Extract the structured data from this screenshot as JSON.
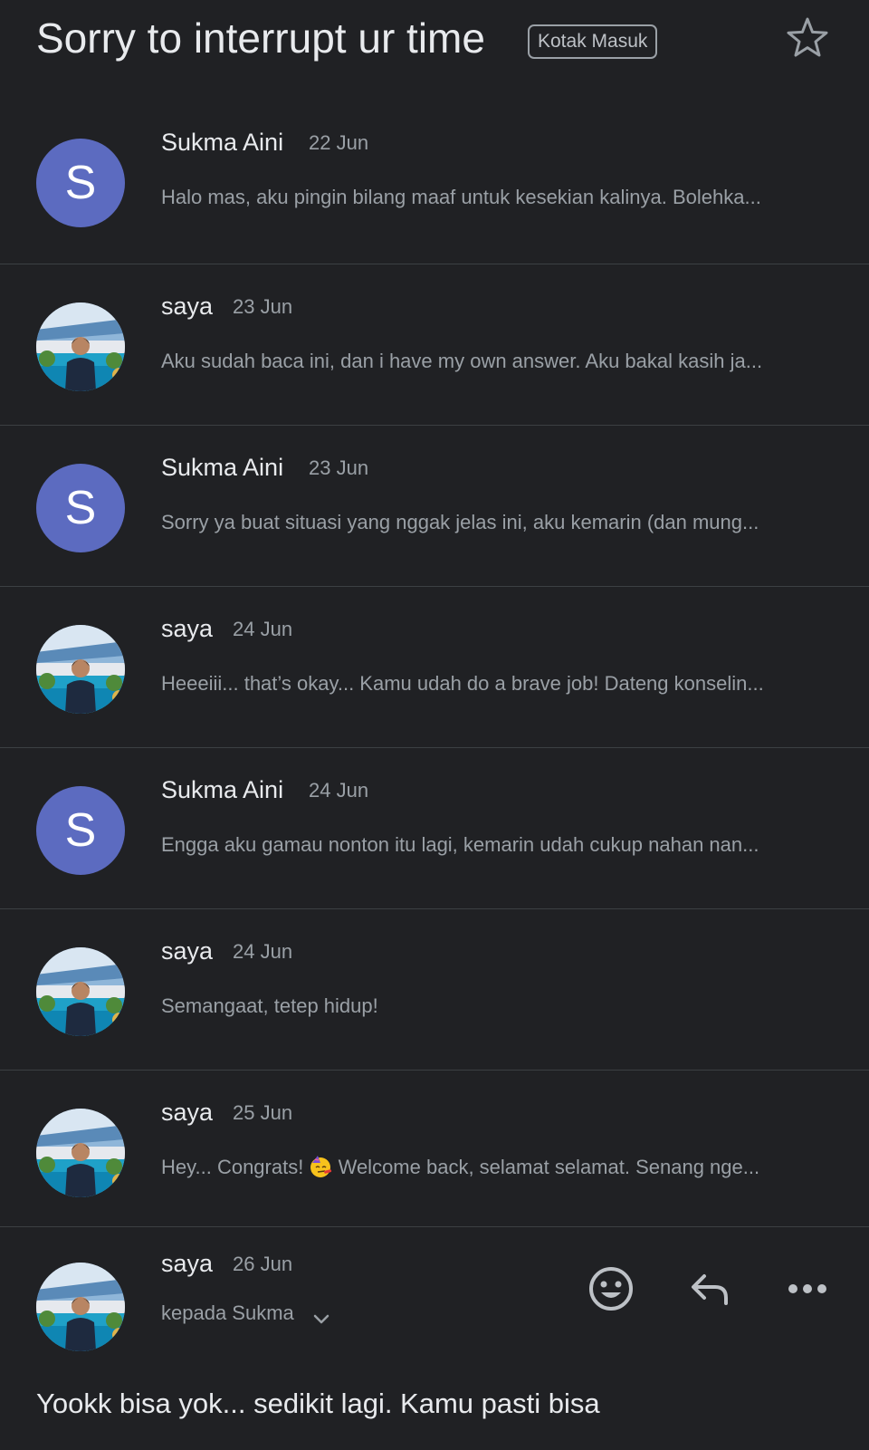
{
  "header": {
    "subject": "Sorry to interrupt ur time",
    "label": "Kotak Masuk",
    "star_icon": "star-outline-icon"
  },
  "messages": [
    {
      "sender": "Sukma Aini",
      "date": "22 Jun",
      "avatar_letter": "S",
      "snippet": "Halo mas, aku pingin bilang maaf untuk kesekian kalinya. Bolehka..."
    },
    {
      "sender": "saya",
      "date": "23 Jun",
      "snippet": "Aku sudah baca ini, dan i have my own answer. Aku bakal kasih ja..."
    },
    {
      "sender": "Sukma Aini",
      "date": "23 Jun",
      "avatar_letter": "S",
      "snippet": "Sorry ya buat situasi yang nggak jelas ini, aku kemarin (dan mung..."
    },
    {
      "sender": "saya",
      "date": "24 Jun",
      "snippet": "Heeeiii... that’s okay... Kamu udah do a brave job! Dateng konselin..."
    },
    {
      "sender": "Sukma Aini",
      "date": "24 Jun",
      "avatar_letter": "S",
      "snippet": "Engga aku gamau nonton itu lagi, kemarin udah cukup nahan nan..."
    },
    {
      "sender": "saya",
      "date": "24 Jun",
      "snippet": "Semangaat, tetep hidup!"
    },
    {
      "sender": "saya",
      "date": "25 Jun",
      "snippet_before": "Hey... Congrats!",
      "snippet_after": "Welcome back, selamat selamat. Senang nge..."
    }
  ],
  "expanded": {
    "sender": "saya",
    "date": "26 Jun",
    "recipient": "kepada Sukma",
    "body": "Yookk bisa yok... sedikit lagi. Kamu pasti bisa",
    "actions": [
      "emoji-reaction-icon",
      "reply-icon",
      "more-options-icon"
    ]
  },
  "colors": {
    "background": "#202124",
    "avatar_letter_bg": "#5c6bc0",
    "divider": "#3c4043"
  }
}
